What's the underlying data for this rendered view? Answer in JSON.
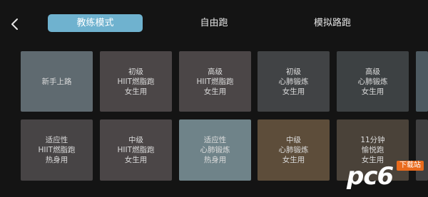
{
  "tabs": [
    {
      "label": "教练模式",
      "active": true
    },
    {
      "label": "自由跑",
      "active": false
    },
    {
      "label": "模拟路跑",
      "active": false
    }
  ],
  "cards_row1": [
    {
      "label": "新手上路",
      "color": "#5f6a70"
    },
    {
      "label": "初级\nHIIT燃脂跑\n女生用",
      "color": "#4b4647"
    },
    {
      "label": "高级\nHIIT燃脂跑\n女生用",
      "color": "#4b4647"
    },
    {
      "label": "初级\n心肺锻炼\n女生用",
      "color": "#414345"
    },
    {
      "label": "高级\n心肺锻炼\n女生用",
      "color": "#3d4143"
    },
    {
      "label": "",
      "color": "#4d5a61"
    }
  ],
  "cards_row2": [
    {
      "label": "适应性\nHIIT燃脂跑\n热身用",
      "color": "#474445"
    },
    {
      "label": "中级\nHIIT燃脂跑\n女生用",
      "color": "#4b4647"
    },
    {
      "label": "适应性\n心肺锻炼\n热身用",
      "color": "#6f8389"
    },
    {
      "label": "中级\n心肺锻炼\n女生用",
      "color": "#5d4d3a"
    },
    {
      "label": "11分钟\n愉悦跑\n女生用",
      "color": "#4a4239"
    },
    {
      "label": "",
      "color": "#3f3f40"
    }
  ],
  "watermark": {
    "text": "pc6",
    "badge": "下载站"
  }
}
